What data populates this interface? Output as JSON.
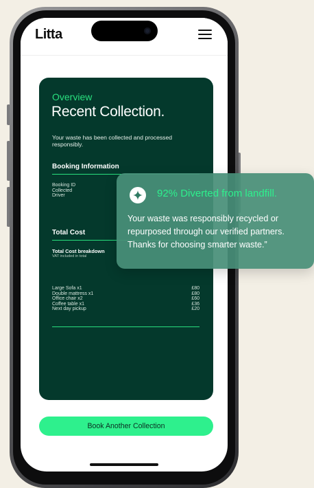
{
  "app": {
    "logo": "Litta"
  },
  "card": {
    "eyebrow": "Overview",
    "title": "Recent Collection.",
    "description": "Your waste has been collected and processed responsibly.",
    "booking_info": {
      "heading": "Booking Information",
      "labels": [
        "Booking ID",
        "Collected",
        "Driver"
      ]
    },
    "total_cost": {
      "heading": "Total Cost",
      "breakdown_title": "Total Cost breakdown",
      "vat_note": "VAT included in total",
      "items": [
        {
          "name": "Large Sofa x1",
          "price": "£80"
        },
        {
          "name": "Double mattress x1",
          "price": "£80"
        },
        {
          "name": "Office chair x2",
          "price": "£60"
        },
        {
          "name": "Coffee table x1",
          "price": "£36"
        },
        {
          "name": "Next day pickup",
          "price": "£20"
        }
      ]
    }
  },
  "cta": {
    "label": "Book Another Collection"
  },
  "overlay": {
    "icon": "sparkle-icon",
    "title": "92% Diverted from landfill.",
    "body": "Your waste was responsibly recycled or repurposed through our verified partners. Thanks for choosing smarter waste.”"
  },
  "colors": {
    "background": "#f3efe5",
    "card": "#04392c",
    "accent": "#2ef08d",
    "overlay": "#488f78"
  }
}
